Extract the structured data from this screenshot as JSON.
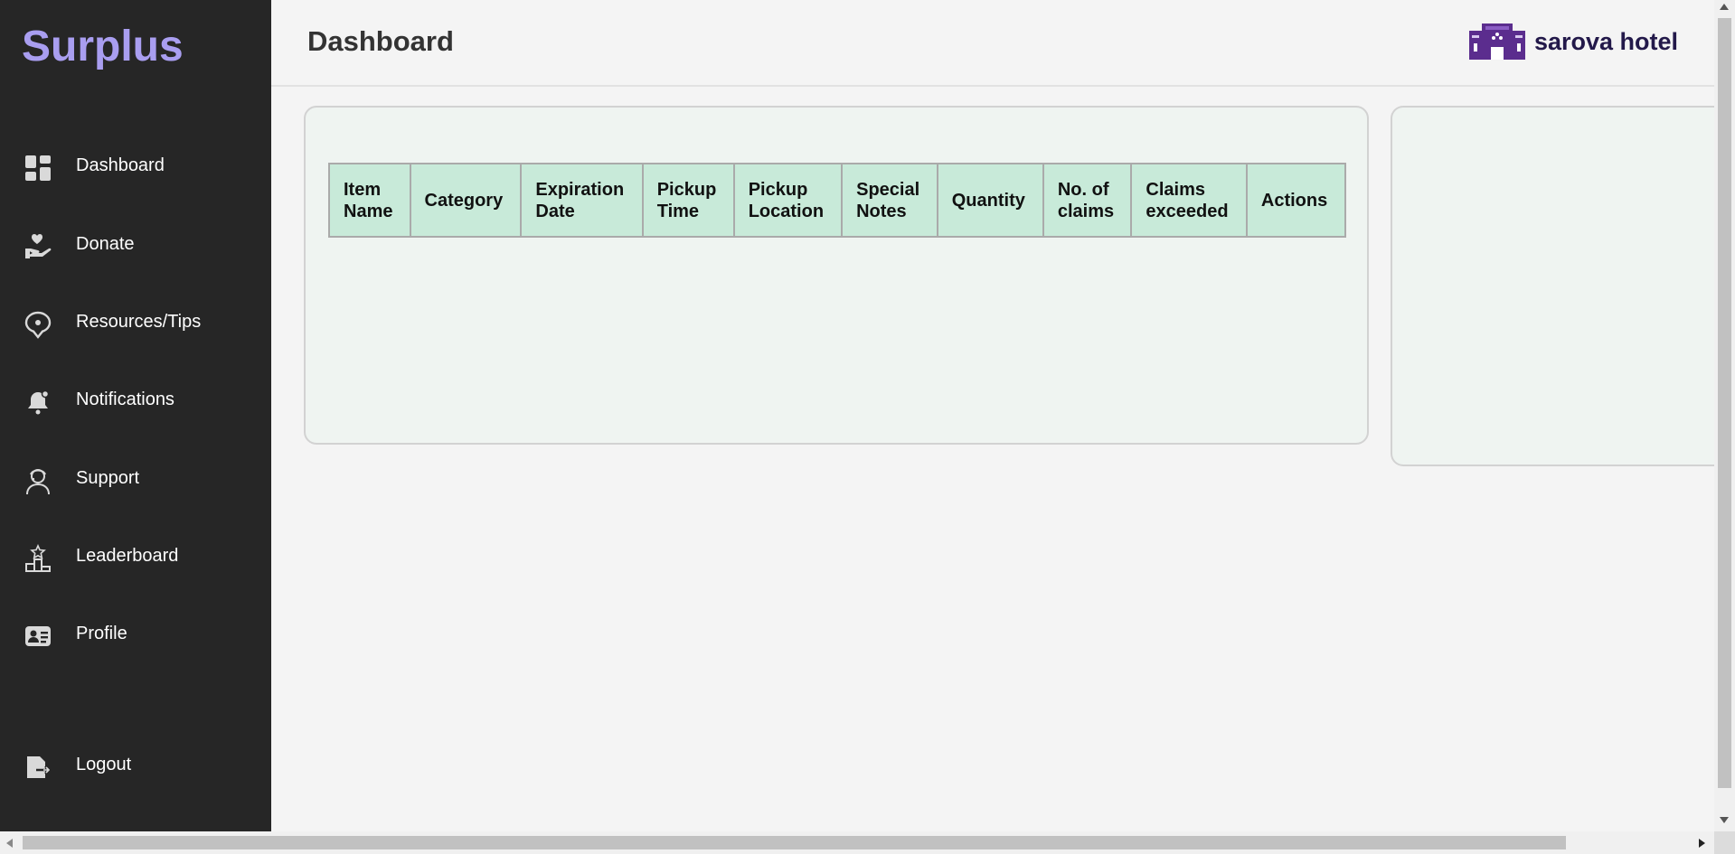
{
  "app": {
    "logo": "Surplus"
  },
  "sidebar": {
    "items": [
      {
        "label": "Dashboard",
        "icon": "dashboard-icon"
      },
      {
        "label": "Donate",
        "icon": "donate-hand-heart-icon"
      },
      {
        "label": "Resources/Tips",
        "icon": "chat-bubble-icon"
      },
      {
        "label": "Notifications",
        "icon": "bell-icon"
      },
      {
        "label": "Support",
        "icon": "support-agent-icon"
      },
      {
        "label": "Leaderboard",
        "icon": "podium-icon"
      },
      {
        "label": "Profile",
        "icon": "id-card-icon"
      }
    ],
    "logout": {
      "label": "Logout",
      "icon": "logout-icon"
    }
  },
  "header": {
    "title": "Dashboard",
    "hotel_name": "sarova hotel",
    "hotel_icon": "hotel-building-icon"
  },
  "table": {
    "columns": [
      [
        "Item",
        "Name"
      ],
      [
        "Category",
        ""
      ],
      [
        "Expiration",
        "Date"
      ],
      [
        "Pickup",
        "Time"
      ],
      [
        "Pickup",
        "Location"
      ],
      [
        "Special",
        "Notes"
      ],
      [
        "Quantity",
        ""
      ],
      [
        "No. of",
        "claims"
      ],
      [
        "Claims",
        "exceeded"
      ],
      [
        "Actions",
        ""
      ]
    ],
    "rows": []
  },
  "colors": {
    "sidebar_bg": "#262626",
    "logo": "#a99ef0",
    "brand_purple": "#5b2d8e",
    "table_header_bg": "#c8ead9",
    "card_bg": "#eff4f1"
  }
}
